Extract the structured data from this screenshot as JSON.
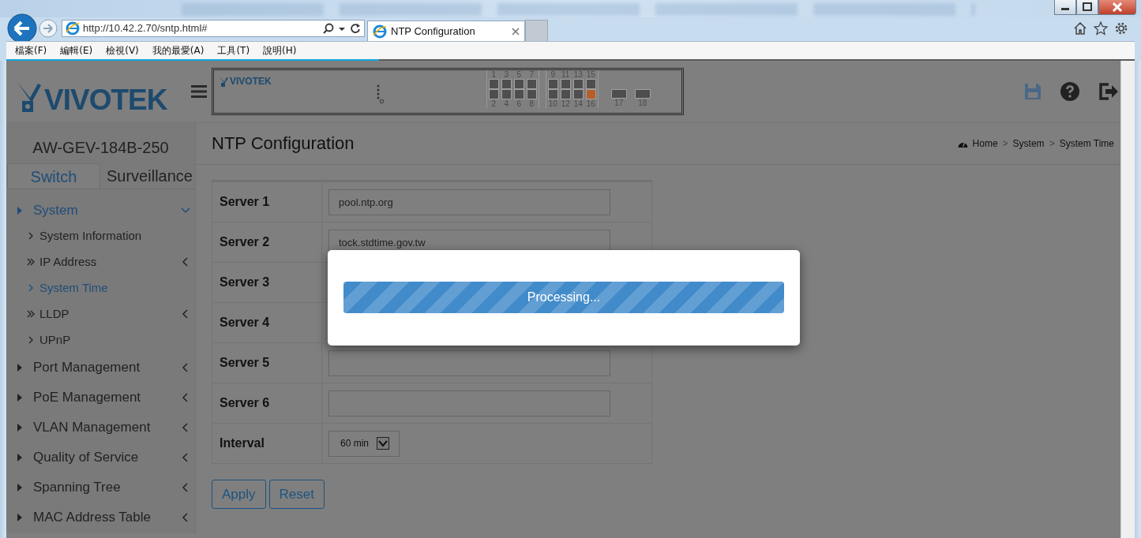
{
  "browser": {
    "address": "http://10.42.2.70/sntp.html#",
    "tab_title": "NTP Configuration",
    "menu": [
      "檔案(F)",
      "編輯(E)",
      "檢視(V)",
      "我的最愛(A)",
      "工具(T)",
      "說明(H)"
    ],
    "loading": {
      "level": 0.33
    }
  },
  "header": {
    "logo": "VIVOTEK",
    "panel": {
      "logo": "VIVOTEK",
      "ports": [
        {
          "label": "1",
          "link": false
        },
        {
          "label": "2",
          "link": false
        },
        {
          "label": "3",
          "link": false
        },
        {
          "label": "4",
          "link": false
        },
        {
          "label": "5",
          "link": false
        },
        {
          "label": "6",
          "link": false
        },
        {
          "label": "7",
          "link": false
        },
        {
          "label": "8",
          "link": false
        },
        {
          "label": "9",
          "link": false
        },
        {
          "label": "10",
          "link": false
        },
        {
          "label": "11",
          "link": false
        },
        {
          "label": "12",
          "link": false
        },
        {
          "label": "13",
          "link": false
        },
        {
          "label": "14",
          "link": false
        },
        {
          "label": "15",
          "link": false
        },
        {
          "label": "16",
          "link": true
        }
      ],
      "sfp": [
        {
          "label": "17",
          "link": false
        },
        {
          "label": "18",
          "link": false
        }
      ]
    }
  },
  "sidebar": {
    "model": "AW-GEV-184B-250",
    "tabs": [
      {
        "label": "Switch",
        "selected": true
      },
      {
        "label": "Surveillance",
        "selected": false
      }
    ],
    "menu": [
      {
        "label": "System",
        "expanded": true,
        "children": [
          {
            "label": "System Information",
            "kind": "page",
            "selected": false
          },
          {
            "label": "IP Address",
            "kind": "group",
            "selected": false
          },
          {
            "label": "System Time",
            "kind": "page",
            "selected": true
          },
          {
            "label": "LLDP",
            "kind": "group",
            "selected": false
          },
          {
            "label": "UPnP",
            "kind": "page",
            "selected": false
          }
        ]
      },
      {
        "label": "Port Management",
        "expanded": false
      },
      {
        "label": "PoE Management",
        "expanded": false
      },
      {
        "label": "VLAN Management",
        "expanded": false
      },
      {
        "label": "Quality of Service",
        "expanded": false
      },
      {
        "label": "Spanning Tree",
        "expanded": false
      },
      {
        "label": "MAC Address Table",
        "expanded": false
      }
    ]
  },
  "content": {
    "title": "NTP Configuration",
    "breadcrumb": {
      "separator": ">",
      "items": [
        "Home",
        "System",
        "System Time"
      ]
    },
    "form": [
      {
        "label": "Server 1",
        "kind": "text",
        "value": "pool.ntp.org"
      },
      {
        "label": "Server 2",
        "kind": "text",
        "value": "tock.stdtime.gov.tw"
      },
      {
        "label": "Server 3",
        "kind": "covered"
      },
      {
        "label": "Server 4",
        "kind": "covered"
      },
      {
        "label": "Server 5",
        "kind": "text"
      },
      {
        "label": "Server 6",
        "kind": "text"
      },
      {
        "label": "Interval",
        "kind": "select",
        "value": "60 min"
      }
    ],
    "buttons": [
      "Apply",
      "Reset"
    ]
  },
  "dialog": {
    "progress": {
      "label": "Processing...",
      "level": 1
    }
  }
}
